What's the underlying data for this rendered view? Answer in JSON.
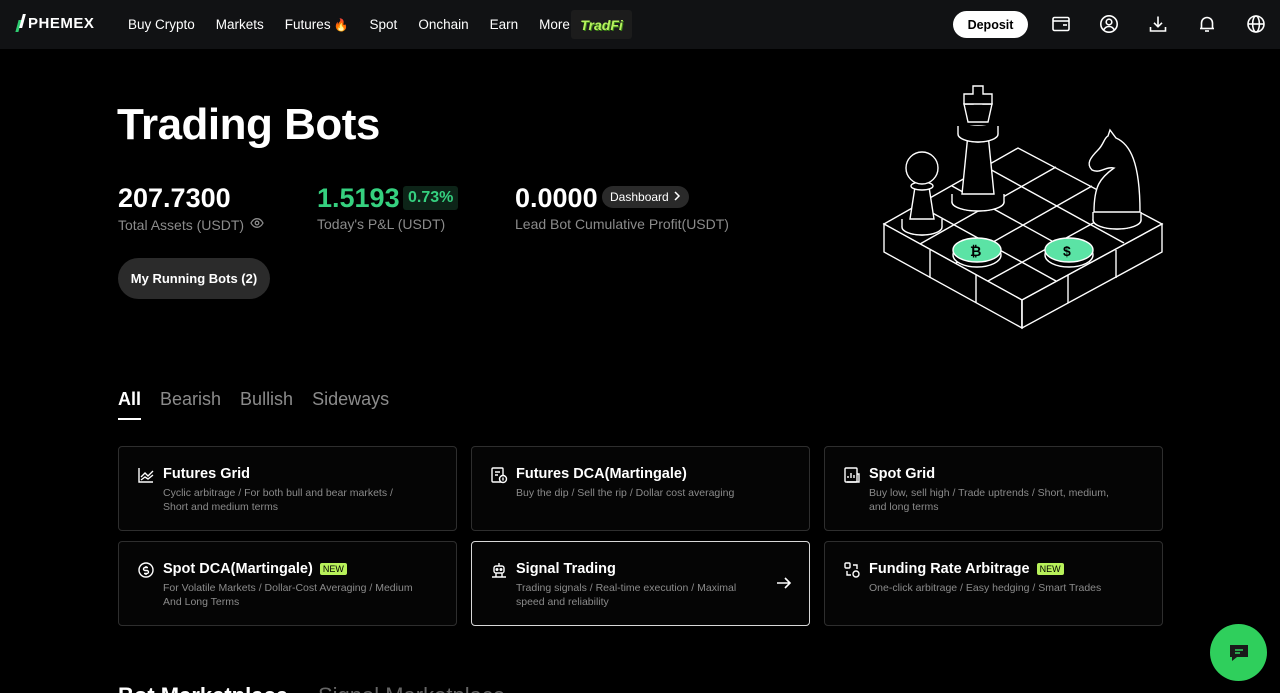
{
  "nav": {
    "logo": "PHEMEX",
    "items": [
      "Buy Crypto",
      "Markets",
      "Futures",
      "Spot",
      "Onchain",
      "Earn",
      "More"
    ],
    "tradfi": "TradFi",
    "deposit": "Deposit"
  },
  "hero": {
    "title": "Trading Bots",
    "total_assets": "207.7300",
    "total_assets_label": "Total Assets (USDT)",
    "pnl": "1.5193",
    "pnl_pct": "0.73%",
    "pnl_label": "Today's P&L (USDT)",
    "lead_profit": "0.0000",
    "dashboard": "Dashboard",
    "lead_profit_label": "Lead Bot Cumulative Profit(USDT)",
    "running_bots": "My Running Bots (2)"
  },
  "tabs": [
    "All",
    "Bearish",
    "Bullish",
    "Sideways"
  ],
  "cards": [
    {
      "title": "Futures Grid",
      "desc": "Cyclic arbitrage / For both bull and bear markets / Short and medium terms",
      "badge": ""
    },
    {
      "title": "Futures DCA(Martingale)",
      "desc": "Buy the dip / Sell the rip / Dollar cost averaging",
      "badge": ""
    },
    {
      "title": "Spot Grid",
      "desc": "Buy low, sell high / Trade uptrends / Short, medium, and long terms",
      "badge": ""
    },
    {
      "title": "Spot DCA(Martingale)",
      "desc": "For Volatile Markets / Dollar-Cost Averaging / Medium And Long Terms",
      "badge": "NEW"
    },
    {
      "title": "Signal Trading",
      "desc": "Trading signals / Real-time execution / Maximal speed and reliability",
      "badge": ""
    },
    {
      "title": "Funding Rate Arbitrage",
      "desc": "One-click arbitrage / Easy hedging / Smart Trades",
      "badge": "NEW"
    }
  ],
  "bottom_tabs": [
    "Bot Marketplace",
    "Signal Marketplace"
  ],
  "colors": {
    "accent_green": "#35d07f",
    "badge_green": "#b8f15a",
    "chat_green": "#2fcf5c"
  },
  "icons": [
    "wallet-icon",
    "user-icon",
    "download-icon",
    "bell-icon",
    "globe-icon",
    "eye-icon",
    "chat-icon",
    "arrow-right-icon"
  ]
}
